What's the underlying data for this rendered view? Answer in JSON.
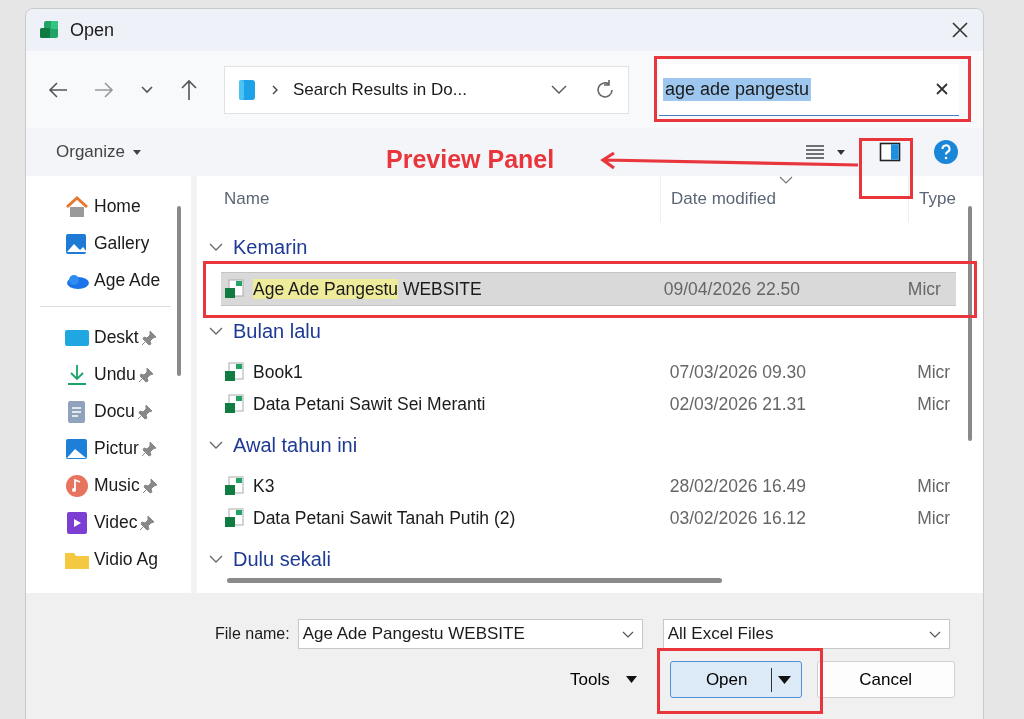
{
  "window": {
    "title": "Open"
  },
  "address": {
    "crumb": "Search Results in Do..."
  },
  "search": {
    "value": "age ade pangestu"
  },
  "toolbar": {
    "organize": "Organize"
  },
  "sidebar": {
    "sections": [
      [
        {
          "label": "Home",
          "kind": "home",
          "pinned": false
        },
        {
          "label": "Gallery",
          "kind": "gallery",
          "pinned": false
        },
        {
          "label": "Age Ade",
          "kind": "cloud",
          "pinned": false
        }
      ],
      [
        {
          "label": "Deskt",
          "kind": "desktop",
          "pinned": true
        },
        {
          "label": "Undu",
          "kind": "download",
          "pinned": true
        },
        {
          "label": "Docu",
          "kind": "document",
          "pinned": true
        },
        {
          "label": "Pictur",
          "kind": "pictures",
          "pinned": true
        },
        {
          "label": "Music",
          "kind": "music",
          "pinned": true
        },
        {
          "label": "Videc",
          "kind": "videos",
          "pinned": true
        },
        {
          "label": "Vidio Ag",
          "kind": "folder",
          "pinned": false
        }
      ]
    ]
  },
  "table": {
    "columns": [
      "Name",
      "Date modified",
      "Type"
    ],
    "groups": [
      {
        "label": "Kemarin",
        "expanded": true,
        "files": [
          {
            "match": "Age Ade Pangestu",
            "rest": "WEBSITE",
            "date": "09/04/2026 22.50",
            "type": "Micr",
            "selected": true
          }
        ]
      },
      {
        "label": "Bulan lalu",
        "expanded": true,
        "files": [
          {
            "rest": "Book1",
            "date": "07/03/2026 09.30",
            "type": "Micr",
            "selected": false
          },
          {
            "rest": "Data Petani Sawit Sei Meranti",
            "date": "02/03/2026 21.31",
            "type": "Micr",
            "selected": false
          }
        ]
      },
      {
        "label": "Awal tahun ini",
        "expanded": true,
        "files": [
          {
            "rest": "K3",
            "date": "28/02/2026 16.49",
            "type": "Micr",
            "selected": false
          },
          {
            "rest": "Data Petani Sawit Tanah Putih (2)",
            "date": "03/02/2026 16.12",
            "type": "Micr",
            "selected": false
          }
        ]
      },
      {
        "label": "Dulu sekali",
        "expanded": true
      }
    ]
  },
  "footer": {
    "file_name_label": "File name:",
    "file_name": "Age Ade Pangestu WEBSITE",
    "filter": "All Excel Files",
    "tools": "Tools",
    "open": "Open",
    "cancel": "Cancel"
  },
  "annotation": {
    "label": "Preview Panel"
  }
}
